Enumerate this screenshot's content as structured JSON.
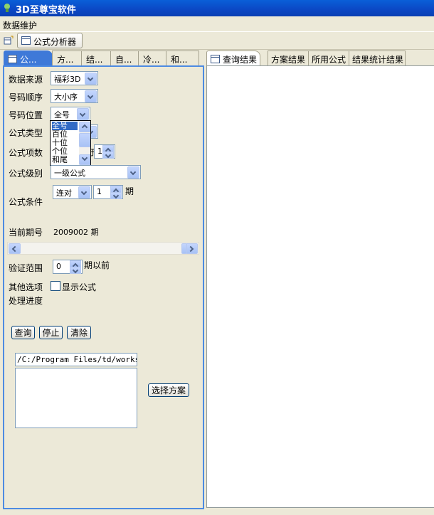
{
  "window": {
    "title": "3D至尊宝软件"
  },
  "menu": {
    "items": [
      "数据维护"
    ]
  },
  "toolbar": {
    "analyzer_tab": "公式分析器"
  },
  "left_tabs": [
    "公...",
    "方...",
    "结...",
    "自...",
    "冷...",
    "和..."
  ],
  "right_tabs": [
    "查询结果",
    "方案结果",
    "所用公式",
    "结果统计结果"
  ],
  "form": {
    "data_source_label": "数据来源",
    "data_source_value": "福彩3D",
    "order_label": "号码顺序",
    "order_value": "大小序",
    "position_label": "号码位置",
    "position_value": "全号",
    "position_options": [
      "全号",
      "百位",
      "十位",
      "个位",
      "和尾"
    ],
    "formula_type_label": "公式类型",
    "formula_items_label": "公式项数",
    "formula_items_partial": "于",
    "formula_items_value": "1",
    "formula_level_label": "公式级别",
    "formula_level_value": "一级公式",
    "condition_label": "公式条件",
    "condition_value": "连对",
    "condition_spin": "1",
    "condition_unit": "期",
    "current_period_label": "当前期号",
    "current_period_value": "2009002 期",
    "verify_label": "验证范围",
    "verify_value": "0",
    "verify_unit": "期以前",
    "other_label": "其他选项",
    "show_formula": "显示公式",
    "progress_label": "处理进度"
  },
  "buttons": {
    "query": "查询",
    "stop": "停止",
    "clear": "清除",
    "choose_plan": "选择方案"
  },
  "path_field": "/C:/Program Files/td/workspace",
  "colors": {
    "titlebar": "#0b47c4",
    "tab_active": "#3e79d8",
    "selection": "#316ac5"
  }
}
